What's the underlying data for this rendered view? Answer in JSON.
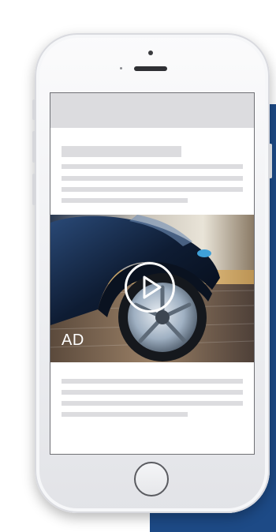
{
  "ad": {
    "label": "AD",
    "play_icon": "play-circle-icon"
  },
  "colors": {
    "backdrop": "#1d4a86",
    "placeholder": "#dcdcdf",
    "phone_body": "#f1f2f4"
  }
}
